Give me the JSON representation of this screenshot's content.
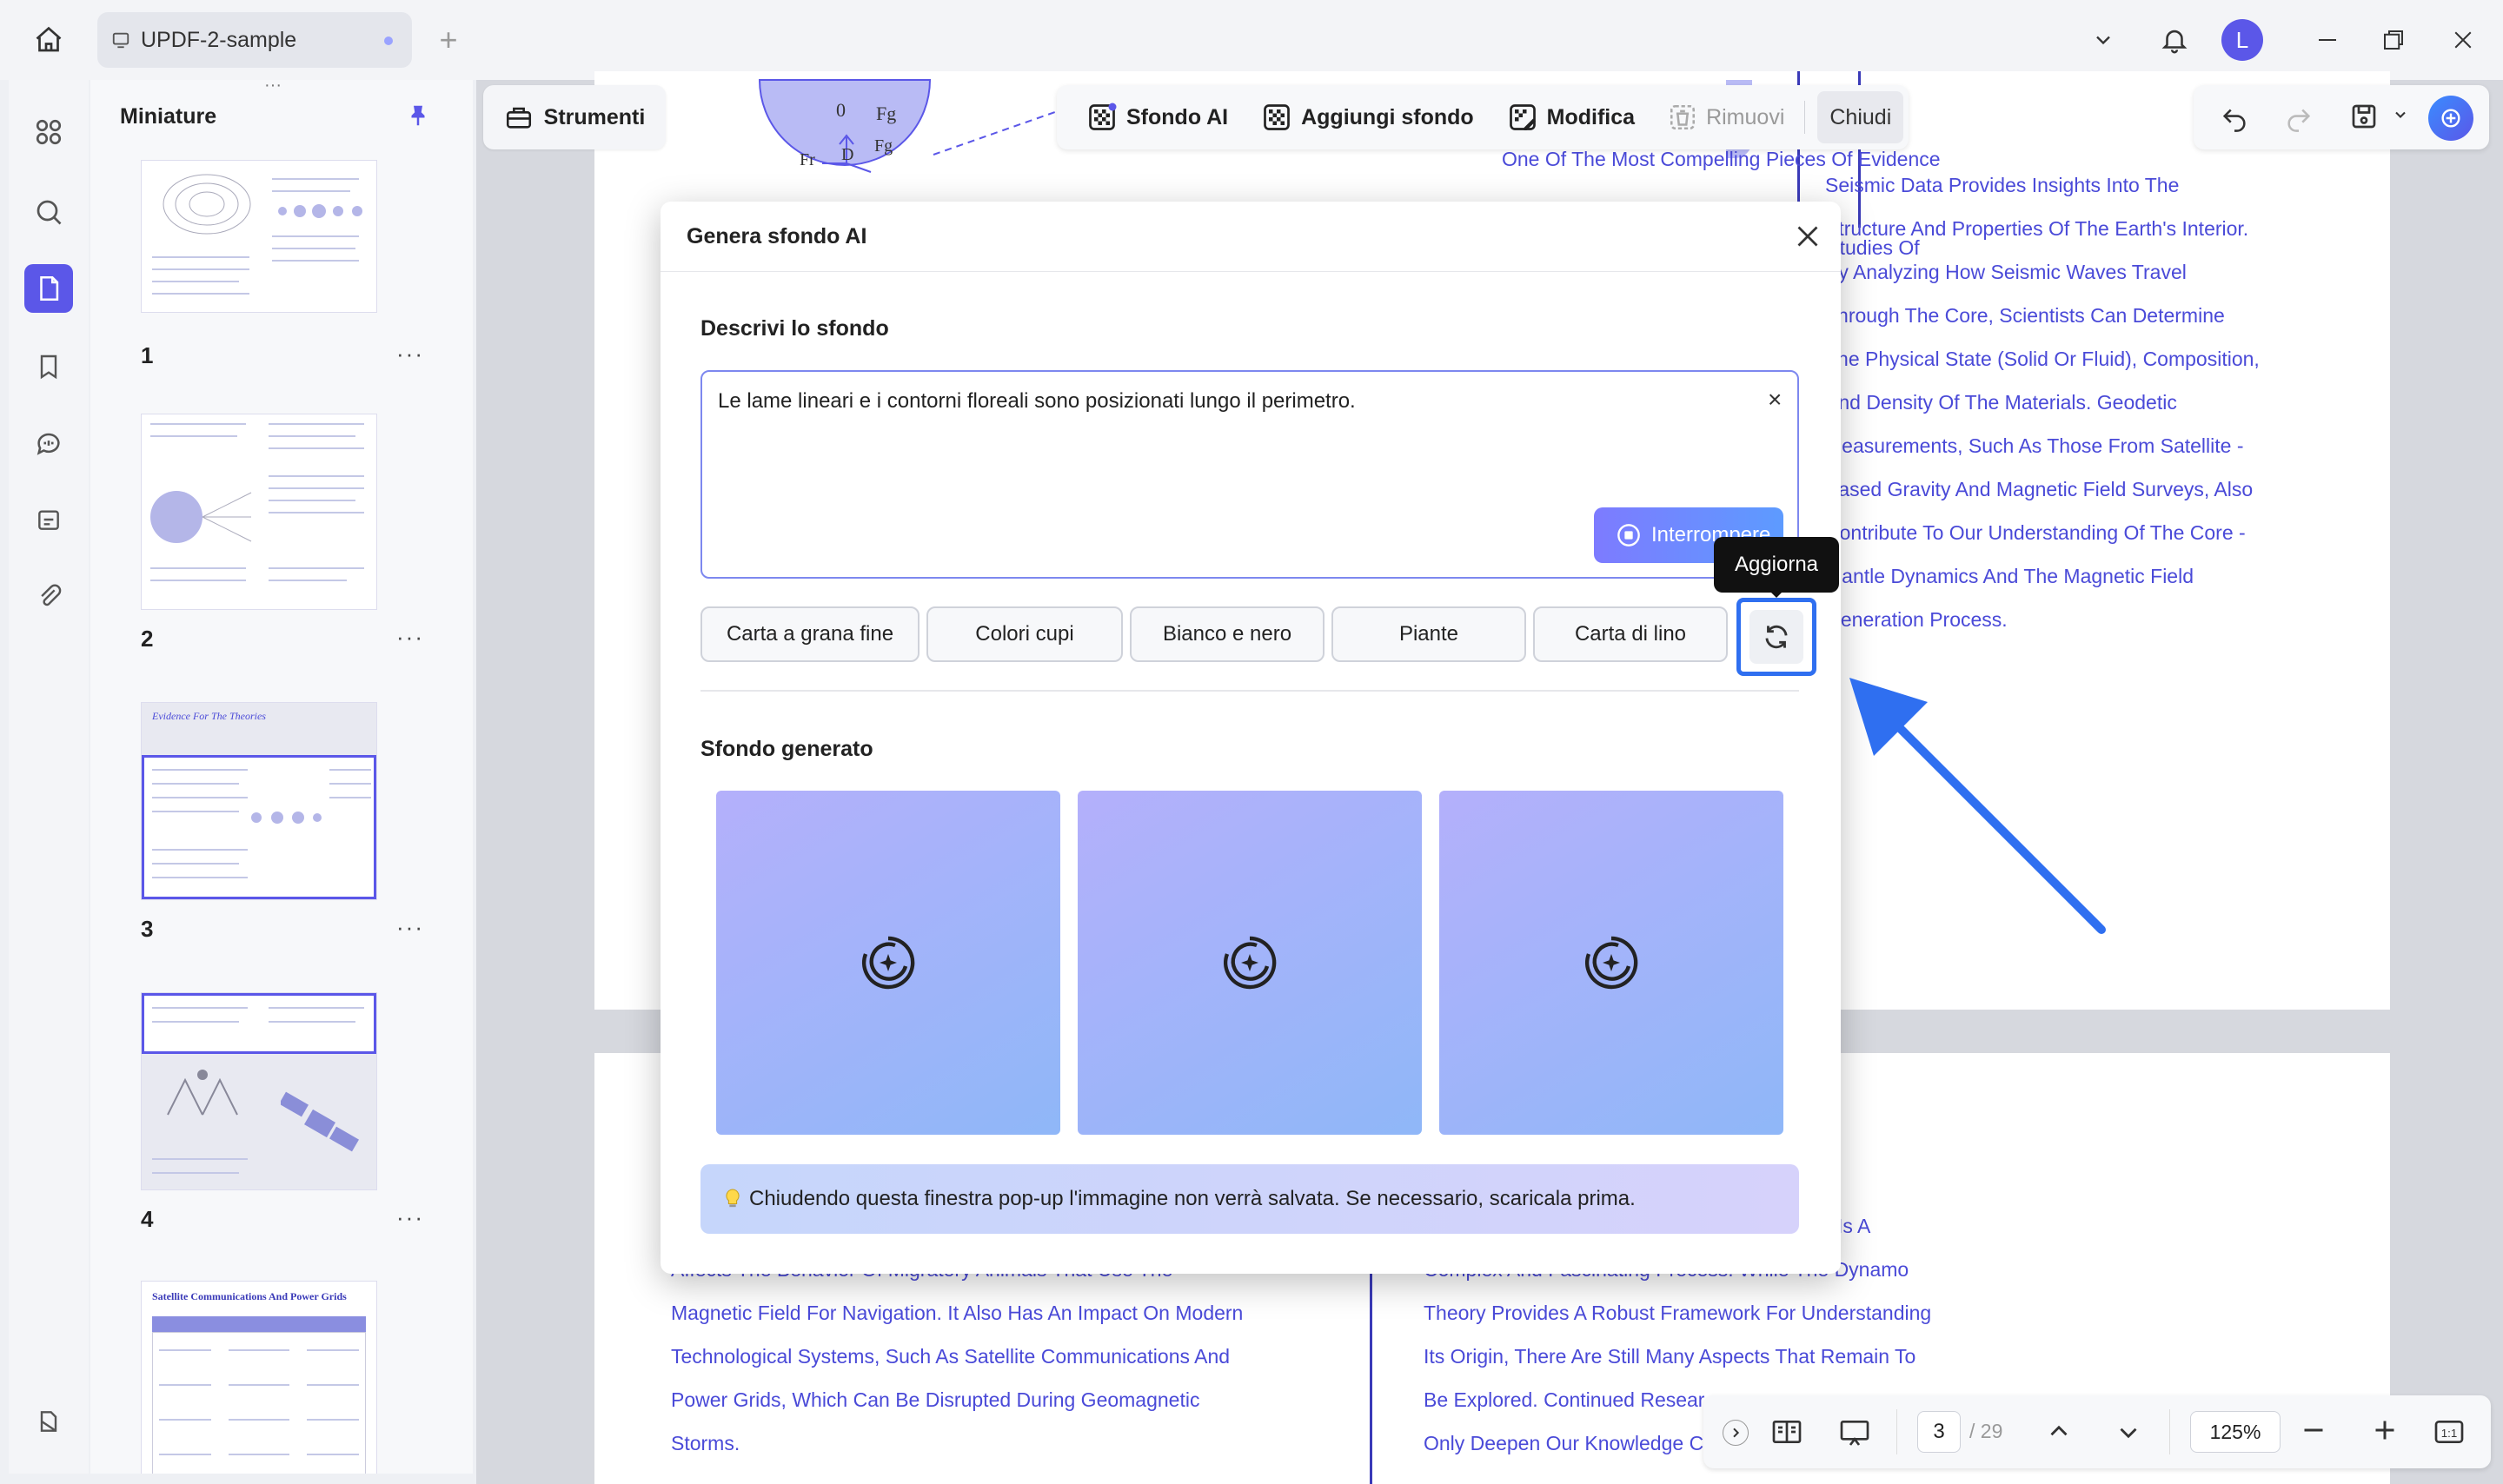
{
  "titlebar": {
    "tab_title": "UPDF-2-sample",
    "avatar_initial": "L"
  },
  "thumbnails": {
    "title": "Miniature",
    "pages": [
      {
        "number": "1",
        "more": "···"
      },
      {
        "number": "2",
        "more": "···"
      },
      {
        "number": "3",
        "more": "···",
        "heading": "Evidence For The Theories"
      },
      {
        "number": "4",
        "more": "···"
      },
      {
        "heading": "Satellite Communications And Power Grids"
      }
    ]
  },
  "strumenti": {
    "label": "Strumenti"
  },
  "toolbar": {
    "sfondo_ai": "Sfondo AI",
    "aggiungi_sfondo": "Aggiungi sfondo",
    "modifica": "Modifica",
    "rimuovi": "Rimuovi",
    "chiudi": "Chiudi"
  },
  "document": {
    "top_center_lines": [
      "One Of The Most Compelling Pieces Of Evidence",
      "Geomagnetic Reversals. Geological Studies Of"
    ],
    "right_column_lines": [
      "Seismic Data Provides Insights Into The",
      "Structure And Properties Of The Earth's Interior.",
      "By Analyzing How Seismic Waves Travel",
      "Through The Core, Scientists Can Determine",
      "The Physical State (Solid Or Fluid), Composition,",
      "And Density Of The Materials. Geodetic",
      "Measurements, Such As Those From Satellite -",
      "Based Gravity And Magnetic Field Surveys, Also",
      "Contribute To Our Understanding Of The Core -",
      "Mantle Dynamics And The Magnetic Field",
      "Generation Process."
    ],
    "bottom_left_lines": [
      "Affects The Behavior Of Migratory Animals That Use The",
      "Magnetic Field For Navigation. It Also Has An Impact On Modern",
      "Technological Systems, Such As Satellite Communications And",
      "Power Grids, Which Can Be Disrupted During Geomagnetic",
      "Storms."
    ],
    "bottom_right_lines": [
      "Is A",
      "Complex And Fascinating Process. While The Dynamo",
      "Theory Provides A Robust Framework For Understanding",
      "Its Origin, There Are Still Many Aspects That Remain To",
      "Be Explored. Continued Resear",
      "Only Deepen Our Knowledge C"
    ],
    "diagram_labels": [
      "0",
      "Fg",
      "Fr",
      "D",
      "Fg"
    ]
  },
  "dialog": {
    "title": "Genera sfondo AI",
    "describe_label": "Descrivi lo sfondo",
    "prompt_value": "Le lame lineari e i contorni floreali sono posizionati lungo il perimetro.",
    "stop_button": "Interrompere",
    "chips": [
      "Carta a grana fine",
      "Colori cupi",
      "Bianco e nero",
      "Piante",
      "Carta di lino"
    ],
    "refresh_tooltip": "Aggiorna",
    "generated_label": "Sfondo generato",
    "note": "Chiudendo questa finestra pop-up l'immagine non verrà salvata. Se necessario, scaricala prima."
  },
  "pagenav": {
    "current_page": "3",
    "total": "/ 29",
    "zoom": "125%"
  },
  "colors": {
    "accent": "#5b57e8",
    "link_text": "#4a4ad8",
    "highlight": "#2f6ff0"
  }
}
